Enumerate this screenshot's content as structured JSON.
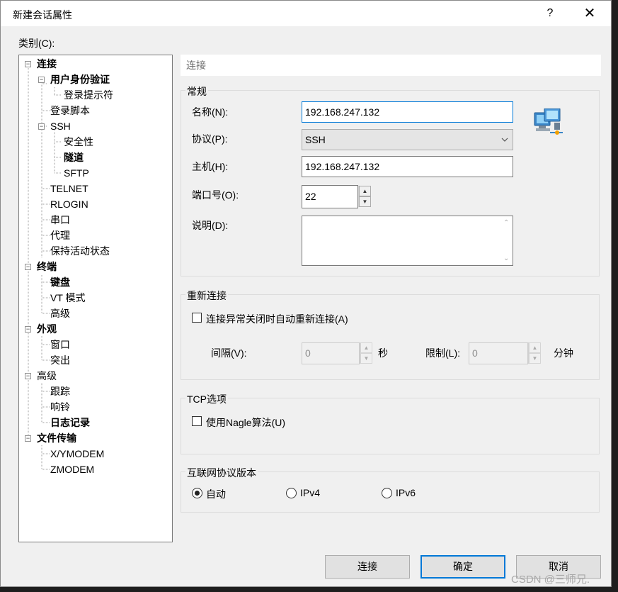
{
  "dialog": {
    "title": "新建会话属性",
    "help_label": "?",
    "close_label": "✕"
  },
  "category_label": "类别(C):",
  "tree": [
    {
      "label": "连接",
      "bold": true
    },
    {
      "label": "用户身份验证",
      "bold": true
    },
    {
      "label": "登录提示符",
      "bold": false
    },
    {
      "label": "登录脚本",
      "bold": false
    },
    {
      "label": "SSH",
      "bold": false
    },
    {
      "label": "安全性",
      "bold": false
    },
    {
      "label": "隧道",
      "bold": true
    },
    {
      "label": "SFTP",
      "bold": false
    },
    {
      "label": "TELNET",
      "bold": false
    },
    {
      "label": "RLOGIN",
      "bold": false
    },
    {
      "label": "串口",
      "bold": false
    },
    {
      "label": "代理",
      "bold": false
    },
    {
      "label": "保持活动状态",
      "bold": false
    },
    {
      "label": "终端",
      "bold": true
    },
    {
      "label": "键盘",
      "bold": true
    },
    {
      "label": "VT 模式",
      "bold": false
    },
    {
      "label": "高级",
      "bold": false
    },
    {
      "label": "外观",
      "bold": true
    },
    {
      "label": "窗口",
      "bold": false
    },
    {
      "label": "突出",
      "bold": false
    },
    {
      "label": "高级",
      "bold": false
    },
    {
      "label": "跟踪",
      "bold": false
    },
    {
      "label": "响铃",
      "bold": false
    },
    {
      "label": "日志记录",
      "bold": true
    },
    {
      "label": "文件传输",
      "bold": true
    },
    {
      "label": "X/YMODEM",
      "bold": false
    },
    {
      "label": "ZMODEM",
      "bold": false
    }
  ],
  "content_header": "连接",
  "general": {
    "group_label": "常规",
    "name_label": "名称(N):",
    "name_value": "192.168.247.132",
    "protocol_label": "协议(P):",
    "protocol_value": "SSH",
    "host_label": "主机(H):",
    "host_value": "192.168.247.132",
    "port_label": "端口号(O):",
    "port_value": "22",
    "desc_label": "说明(D):",
    "desc_value": ""
  },
  "reconnect": {
    "group_label": "重新连接",
    "checkbox_label": "连接异常关闭时自动重新连接(A)",
    "checked": false,
    "interval_label": "间隔(V):",
    "interval_value": "0",
    "interval_unit": "秒",
    "limit_label": "限制(L):",
    "limit_value": "0",
    "limit_unit": "分钟"
  },
  "tcp": {
    "group_label": "TCP选项",
    "nagle_label": "使用Nagle算法(U)",
    "checked": false
  },
  "ipver": {
    "group_label": "互联网协议版本",
    "options": [
      "自动",
      "IPv4",
      "IPv6"
    ],
    "selected": "自动"
  },
  "buttons": {
    "connect": "连接",
    "ok": "确定",
    "cancel": "取消"
  },
  "watermark": "CSDN @三师兄."
}
